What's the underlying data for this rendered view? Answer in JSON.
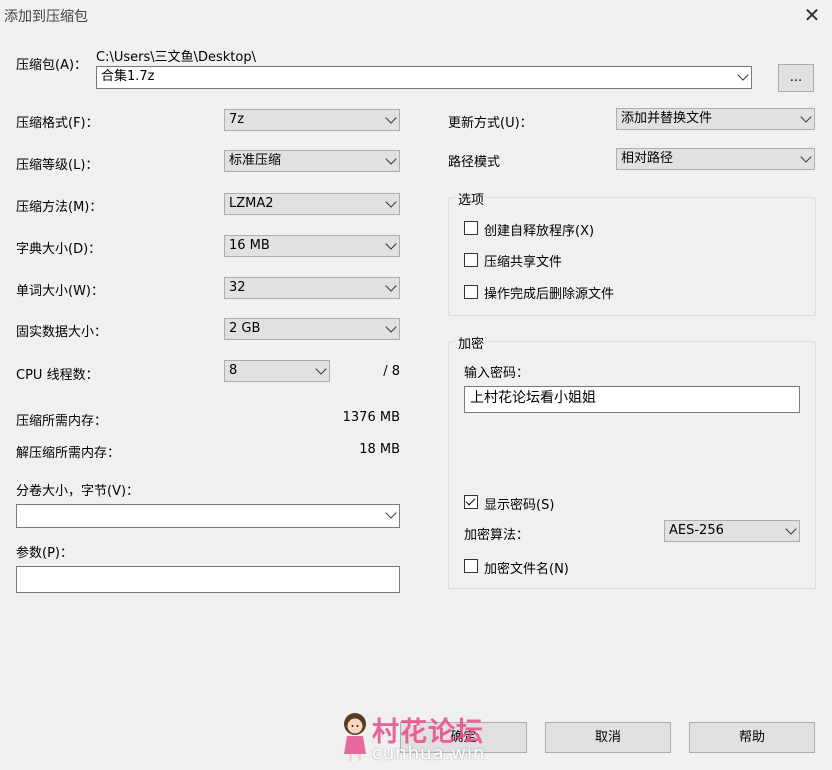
{
  "window": {
    "title": "添加到压缩包",
    "close_glyph": "✕"
  },
  "archive": {
    "label": "压缩包(A)：",
    "path": "C:\\Users\\三文鱼\\Desktop\\",
    "filename": "合集1.7z",
    "browse_label": "..."
  },
  "settings": {
    "format_label": "压缩格式(F)：",
    "format_value": "7z",
    "level_label": "压缩等级(L)：",
    "level_value": "标准压缩",
    "method_label": "压缩方法(M)：",
    "method_value": "LZMA2",
    "dict_label": "字典大小(D)：",
    "dict_value": "16 MB",
    "word_label": "单词大小(W)：",
    "word_value": "32",
    "solid_label": "固实数据大小：",
    "solid_value": "2 GB",
    "threads_label": "CPU 线程数：",
    "threads_value": "8",
    "threads_total": "/ 8",
    "mem_comp_label": "压缩所需内存：",
    "mem_comp_value": "1376 MB",
    "mem_decomp_label": "解压缩所需内存：",
    "mem_decomp_value": "18 MB",
    "volume_label": "分卷大小，字节(V)：",
    "volume_value": "",
    "params_label": "参数(P)：",
    "params_value": ""
  },
  "update": {
    "mode_label": "更新方式(U)：",
    "mode_value": "添加并替换文件",
    "path_label": "路径模式",
    "path_value": "相对路径"
  },
  "options": {
    "title": "选项",
    "sfx_label": "创建自释放程序(X)",
    "sfx_checked": false,
    "shared_label": "压缩共享文件",
    "shared_checked": false,
    "delete_label": "操作完成后删除源文件",
    "delete_checked": false
  },
  "encryption": {
    "title": "加密",
    "password_label": "输入密码：",
    "password_value": "上村花论坛看小姐姐",
    "show_password_label": "显示密码(S)",
    "show_password_checked": true,
    "method_label": "加密算法：",
    "method_value": "AES-256",
    "encrypt_names_label": "加密文件名(N)",
    "encrypt_names_checked": false
  },
  "buttons": {
    "ok": "确定",
    "cancel": "取消",
    "help": "帮助"
  },
  "watermark": {
    "text": "村花论坛",
    "url": "cunhua.win",
    "color": "#e8508f"
  }
}
